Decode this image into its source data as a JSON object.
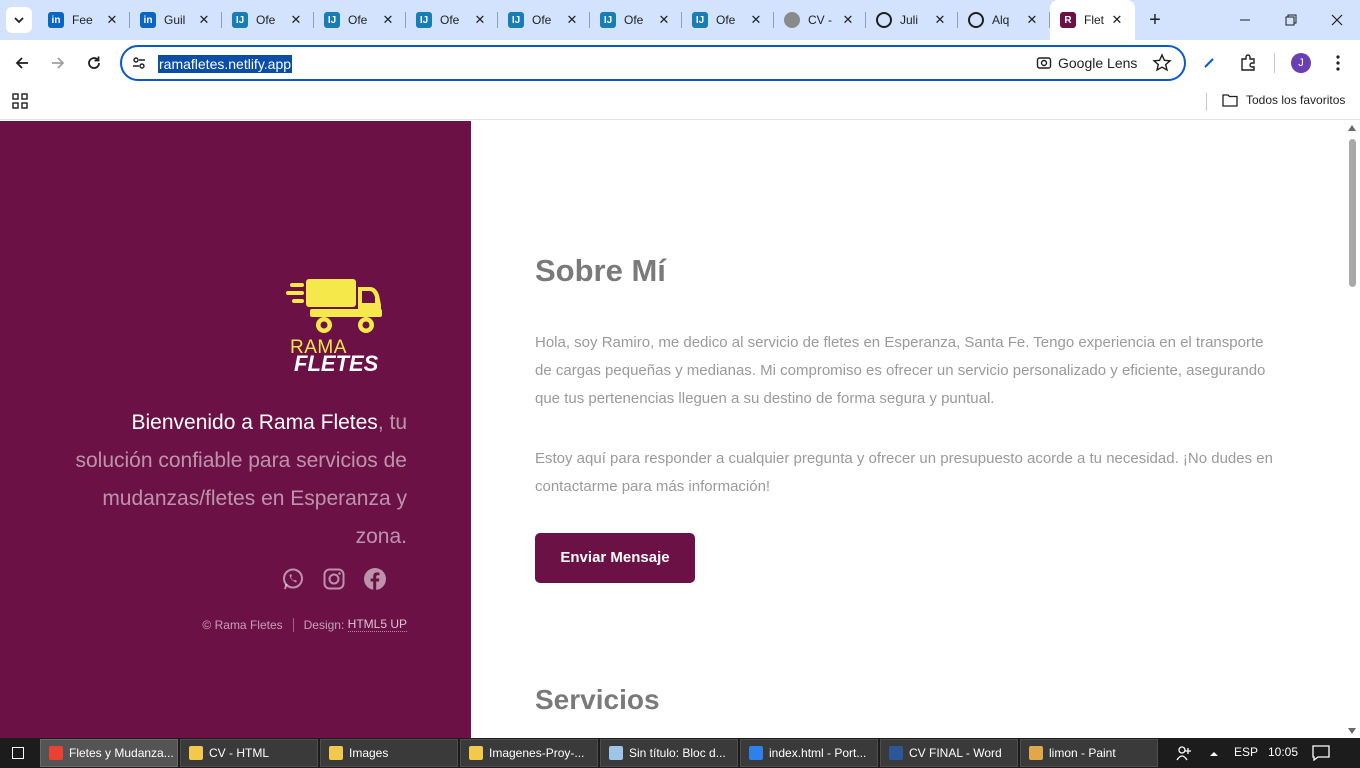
{
  "browser": {
    "tabs": [
      {
        "title": "Fee",
        "favicon": "linkedin-icon",
        "color": "#0a66c2",
        "letter": "in"
      },
      {
        "title": "Guil",
        "favicon": "linkedin-icon",
        "color": "#0a66c2",
        "letter": "in"
      },
      {
        "title": "Ofe",
        "favicon": "infojobs-icon",
        "color": "#167db7",
        "letter": "IJ"
      },
      {
        "title": "Ofe",
        "favicon": "infojobs-icon",
        "color": "#167db7",
        "letter": "IJ"
      },
      {
        "title": "Ofe",
        "favicon": "infojobs-icon",
        "color": "#167db7",
        "letter": "IJ"
      },
      {
        "title": "Ofe",
        "favicon": "infojobs-icon",
        "color": "#167db7",
        "letter": "IJ"
      },
      {
        "title": "Ofe",
        "favicon": "infojobs-icon",
        "color": "#167db7",
        "letter": "IJ"
      },
      {
        "title": "Ofe",
        "favicon": "infojobs-icon",
        "color": "#167db7",
        "letter": "IJ"
      },
      {
        "title": "CV -",
        "favicon": "globe-icon",
        "color": "#8a8a8a",
        "letter": ""
      },
      {
        "title": "Juli",
        "favicon": "circle-icon",
        "color": "#1f1f1f",
        "letter": ""
      },
      {
        "title": "Alq",
        "favicon": "tree-icon",
        "color": "#1f1f1f",
        "letter": ""
      },
      {
        "title": "Flet",
        "favicon": "ramafletes-icon",
        "color": "#6c1145",
        "letter": "R",
        "active": true
      }
    ],
    "url": "ramafletes.netlify.app",
    "lens_label": "Google Lens",
    "avatar_letter": "J",
    "bookmarks_all": "Todos los favoritos"
  },
  "page": {
    "brand_rama": "RAMA",
    "brand_fletes": "FLETES",
    "welcome_strong": "Bienvenido a Rama Fletes",
    "welcome_rest": ", tu solución confiable para servicios de mudanzas/fletes en Esperanza y zona.",
    "footer_copyright": "© Rama Fletes",
    "footer_design_label": "Design:",
    "footer_design_link": "HTML5 UP",
    "about_title": "Sobre Mí",
    "about_p1": "Hola, soy Ramiro, me dedico al servicio de fletes en Esperanza, Santa Fe. Tengo experiencia en el transporte de cargas pequeñas y medianas. Mi compromiso es ofrecer un servicio personalizado y eficiente, asegurando que tus pertenencias lleguen a su destino de forma segura y puntual.",
    "about_p2": "Estoy aquí para responder a cualquier pregunta y ofrecer un presupuesto acorde a tu necesidad. ¡No dudes en contactarme para más información!",
    "send_button": "Enviar Mensaje",
    "services_title": "Servicios",
    "colors": {
      "brand": "#6c1145",
      "logo_yellow": "#f5e84a"
    }
  },
  "taskbar": {
    "items": [
      {
        "label": "Fletes y Mudanza...",
        "icon": "chrome-icon",
        "color": "#e94235",
        "active": true
      },
      {
        "label": "CV - HTML",
        "icon": "folder-icon",
        "color": "#f2c94c"
      },
      {
        "label": "Images",
        "icon": "folder-icon",
        "color": "#f2c94c"
      },
      {
        "label": "Imagenes-Proy-...",
        "icon": "folder-icon",
        "color": "#f2c94c"
      },
      {
        "label": "Sin título: Bloc d...",
        "icon": "notepad-icon",
        "color": "#9ec5e8"
      },
      {
        "label": "index.html - Port...",
        "icon": "vscode-icon",
        "color": "#2f80ed"
      },
      {
        "label": "CV FINAL - Word",
        "icon": "word-icon",
        "color": "#2b579a"
      },
      {
        "label": "limon - Paint",
        "icon": "paint-icon",
        "color": "#e0a84a"
      }
    ],
    "lang": "ESP",
    "time": "10:05"
  }
}
